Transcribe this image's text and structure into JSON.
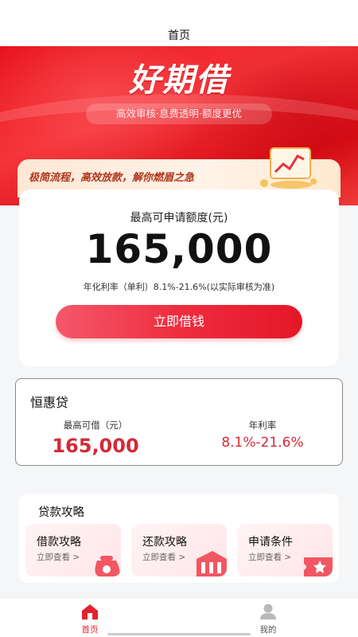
{
  "nav": {
    "title": "首页"
  },
  "hero": {
    "brand": "好期借",
    "slogan": "高效审核·息费透明·额度更优",
    "banner": "极简流程，高效放款，解你燃眉之急",
    "colors": {
      "primary": "#e8101b",
      "accent": "#d42a36"
    }
  },
  "quota": {
    "label": "最高可申请额度(元)",
    "amount": "165,000",
    "rate_text": "年化利率（单利）8.1%-21.6%(以实际审核为准)",
    "button": "立即借钱"
  },
  "product": {
    "name": "恒惠贷",
    "limit_label": "最高可借（元）",
    "limit": "165,000",
    "rate_label": "年利率",
    "rate": "8.1%-21.6%"
  },
  "guide": {
    "title": "贷款攻略",
    "items": [
      {
        "title": "借款攻略",
        "sub": "立即查看 >",
        "icon": "money-bag-icon"
      },
      {
        "title": "还款攻略",
        "sub": "立即查看 >",
        "icon": "bank-icon"
      },
      {
        "title": "申请条件",
        "sub": "立即查看 >",
        "icon": "ticket-star-icon"
      }
    ]
  },
  "tabbar": {
    "items": [
      {
        "label": "首页",
        "icon": "home-icon",
        "active": true
      },
      {
        "label": "我的",
        "icon": "user-icon",
        "active": false
      }
    ]
  }
}
